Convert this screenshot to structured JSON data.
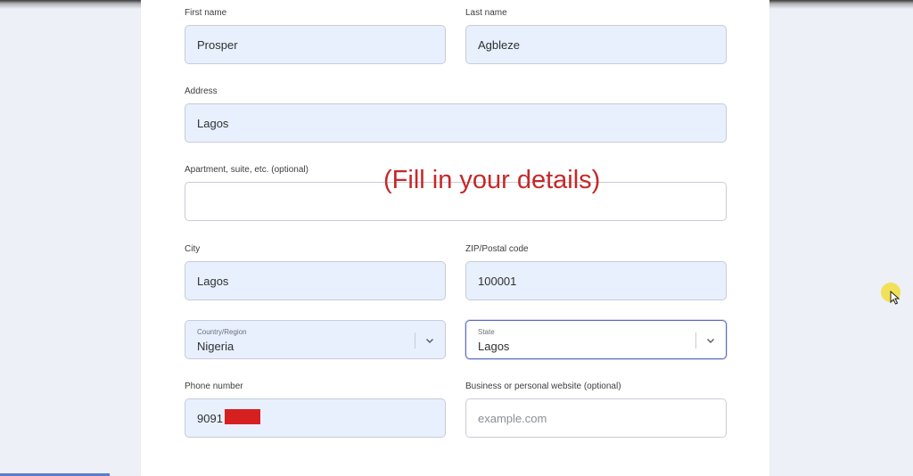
{
  "form": {
    "first_name": {
      "label": "First name",
      "value": "Prosper"
    },
    "last_name": {
      "label": "Last name",
      "value": "Agbleze"
    },
    "address": {
      "label": "Address",
      "value": "Lagos"
    },
    "apartment": {
      "label": "Apartment, suite, etc. (optional)",
      "value": ""
    },
    "city": {
      "label": "City",
      "value": "Lagos"
    },
    "zip": {
      "label": "ZIP/Postal code",
      "value": "100001"
    },
    "country": {
      "sublabel": "Country/Region",
      "value": "Nigeria"
    },
    "state": {
      "sublabel": "State",
      "value": "Lagos"
    },
    "phone": {
      "label": "Phone number",
      "value": "9091"
    },
    "website": {
      "label": "Business or personal website (optional)",
      "placeholder": "example.com",
      "value": ""
    }
  },
  "overlay_note": "(Fill in your details)",
  "icons": {
    "select_chevron": "chevron-down-icon",
    "cursor": "mouse-pointer-icon"
  },
  "colors": {
    "autofill_bg": "#e8f0fe",
    "focus_border": "#5a6bc4",
    "note_text": "#c62828",
    "redaction": "#d62020"
  }
}
